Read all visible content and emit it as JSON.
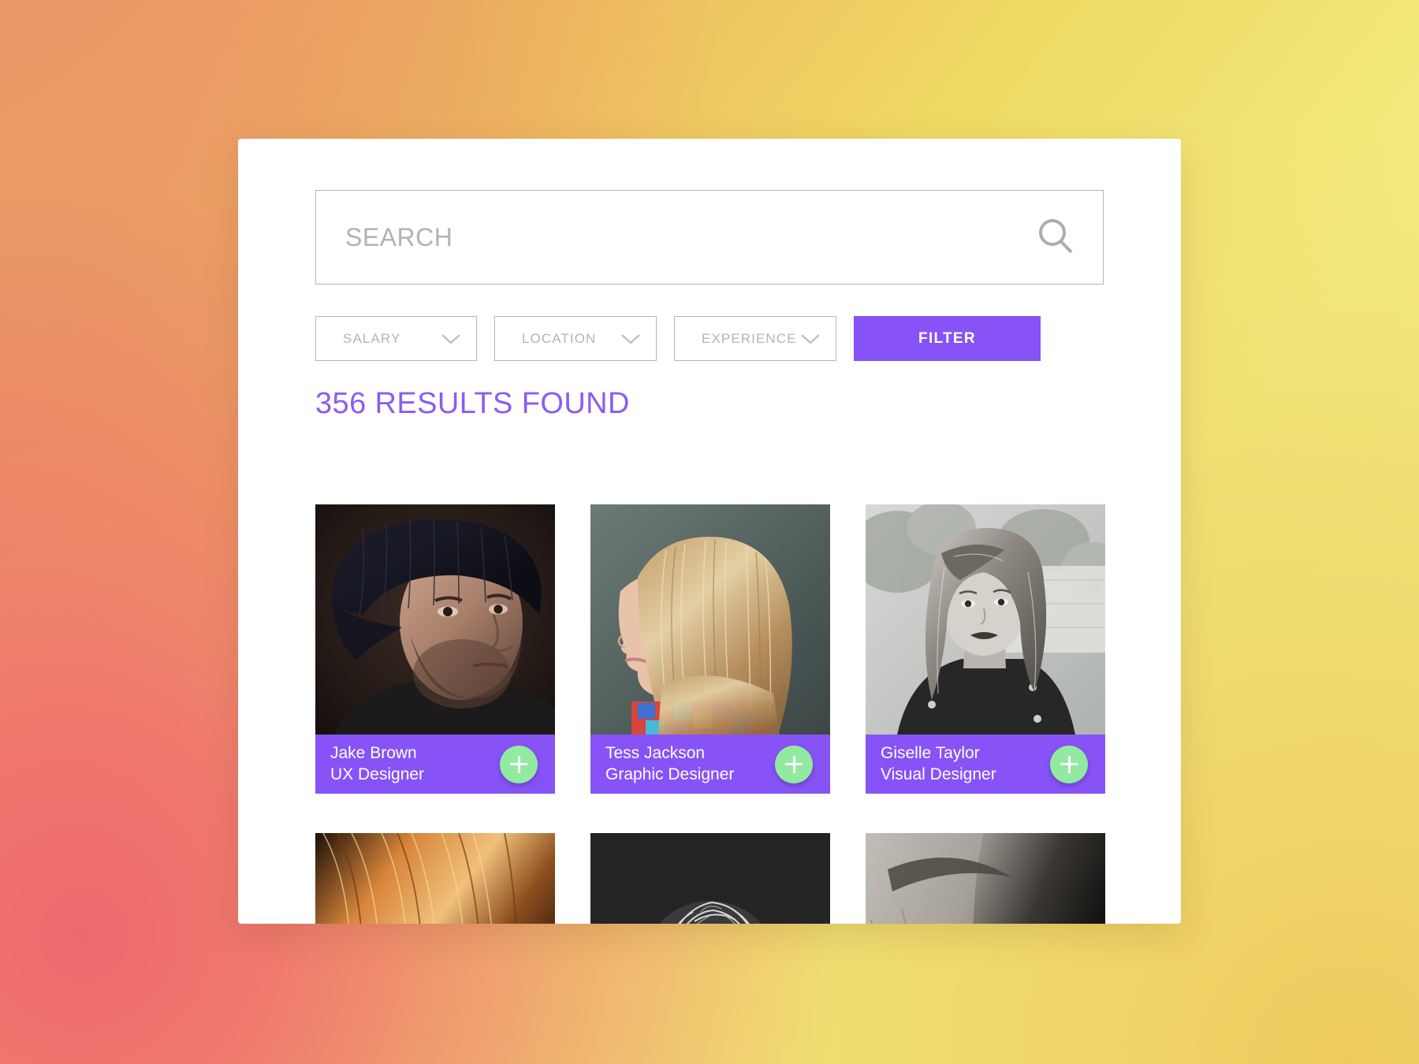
{
  "search": {
    "placeholder": "SEARCH",
    "value": "",
    "icon": "search-icon"
  },
  "filters": {
    "dropdowns": [
      {
        "label": "SALARY",
        "icon": "chevron-down-icon"
      },
      {
        "label": "LOCATION",
        "icon": "chevron-down-icon"
      },
      {
        "label": "EXPERIENCE",
        "icon": "chevron-down-icon"
      }
    ],
    "button_label": "FILTER"
  },
  "results": {
    "heading": "356 RESULTS FOUND",
    "count": 356,
    "cards": [
      {
        "name": "Jake Brown",
        "role": "UX Designer",
        "add_icon": "plus-icon",
        "photo": "man-in-dark-beanie-portrait"
      },
      {
        "name": "Tess Jackson",
        "role": "Graphic Designer",
        "add_icon": "plus-icon",
        "photo": "blonde-woman-profile-portrait"
      },
      {
        "name": "Giselle Taylor",
        "role": "Visual Designer",
        "add_icon": "plus-icon",
        "photo": "black-and-white-woman-portrait"
      }
    ],
    "cards_row2": [
      {
        "photo": "red-golden-hair-closeup"
      },
      {
        "photo": "white-wispy-hair-on-black"
      },
      {
        "photo": "close-up-eye-black-and-white"
      }
    ]
  },
  "colors": {
    "accent_purple": "#8753f7",
    "heading_purple": "#8c5cf0",
    "add_green": "#92eaa1",
    "border_gray": "#b6b6b6",
    "placeholder_gray": "#b2b2b2",
    "card_white": "#ffffff"
  }
}
